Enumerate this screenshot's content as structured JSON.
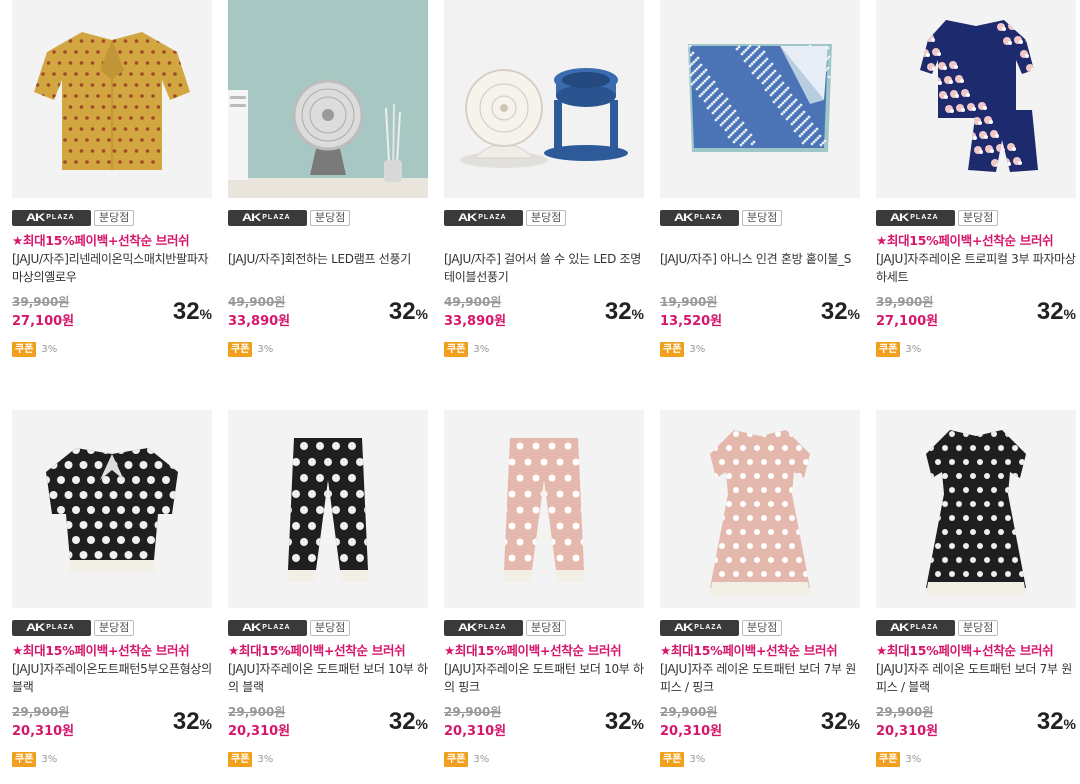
{
  "colors": {
    "promo": "#d6166b",
    "coupon": "#f0a01c",
    "logo_bg": "#3a3a3a"
  },
  "store_badge": {
    "logo_mark": "AK",
    "logo_word": "PLAZA",
    "branch": "분당점"
  },
  "coupon_label": "쿠폰",
  "products": [
    {
      "image": "yellow-dot-shirt",
      "promo": "★최대15%페이백+선착순 브러쉬",
      "name": "[JAJU/자주]리넨레이온믹스매치반팔파자마상의옐로우",
      "original_price": "39,900원",
      "price": "27,100원",
      "discount": "32",
      "discount_unit": "%",
      "coupon_rate": "3%"
    },
    {
      "image": "led-lamp-fan",
      "promo": "",
      "name": "[JAJU/자주]회전하는 LED램프 선풍기",
      "original_price": "49,900원",
      "price": "33,890원",
      "discount": "32",
      "discount_unit": "%",
      "coupon_rate": "3%"
    },
    {
      "image": "table-fans",
      "promo": "",
      "name": "[JAJU/자주] 걸어서 쓸 수 있는 LED 조명테이블선풍기",
      "original_price": "49,900원",
      "price": "33,890원",
      "discount": "32",
      "discount_unit": "%",
      "coupon_rate": "3%"
    },
    {
      "image": "blue-blanket",
      "promo": "",
      "name": "[JAJU/자주] 아니스 인견 혼방 홑이불_S",
      "original_price": "19,900원",
      "price": "13,520원",
      "discount": "32",
      "discount_unit": "%",
      "coupon_rate": "3%"
    },
    {
      "image": "navy-floral-pajama",
      "promo": "★최대15%페이백+선착순 브러쉬",
      "name": "[JAJU]자주레이온 트로피컬 3부 파자마상하세트",
      "original_price": "39,900원",
      "price": "27,100원",
      "discount": "32",
      "discount_unit": "%",
      "coupon_rate": "3%"
    },
    {
      "image": "black-dot-top",
      "promo": "★최대15%페이백+선착순 브러쉬",
      "name": "[JAJU]자주레이온도트패턴5부오픈형상의블랙",
      "original_price": "29,900원",
      "price": "20,310원",
      "discount": "32",
      "discount_unit": "%",
      "coupon_rate": "3%"
    },
    {
      "image": "black-dot-pants",
      "promo": "★최대15%페이백+선착순 브러쉬",
      "name": "[JAJU]자주레이온 도트패턴 보더 10부 하의 블랙",
      "original_price": "29,900원",
      "price": "20,310원",
      "discount": "32",
      "discount_unit": "%",
      "coupon_rate": "3%"
    },
    {
      "image": "pink-dot-pants",
      "promo": "★최대15%페이백+선착순 브러쉬",
      "name": "[JAJU]자주레이온 도트패턴 보더 10부 하의 핑크",
      "original_price": "29,900원",
      "price": "20,310원",
      "discount": "32",
      "discount_unit": "%",
      "coupon_rate": "3%"
    },
    {
      "image": "pink-dot-dress",
      "promo": "★최대15%페이백+선착순 브러쉬",
      "name": "[JAJU]자주 레이온 도트패턴 보더 7부 원피스 / 핑크",
      "original_price": "29,900원",
      "price": "20,310원",
      "discount": "32",
      "discount_unit": "%",
      "coupon_rate": "3%"
    },
    {
      "image": "black-dot-dress",
      "promo": "★최대15%페이백+선착순 브러쉬",
      "name": "[JAJU]자주 레이온 도트패턴 보더 7부 원피스 / 블랙",
      "original_price": "29,900원",
      "price": "20,310원",
      "discount": "32",
      "discount_unit": "%",
      "coupon_rate": "3%"
    }
  ]
}
